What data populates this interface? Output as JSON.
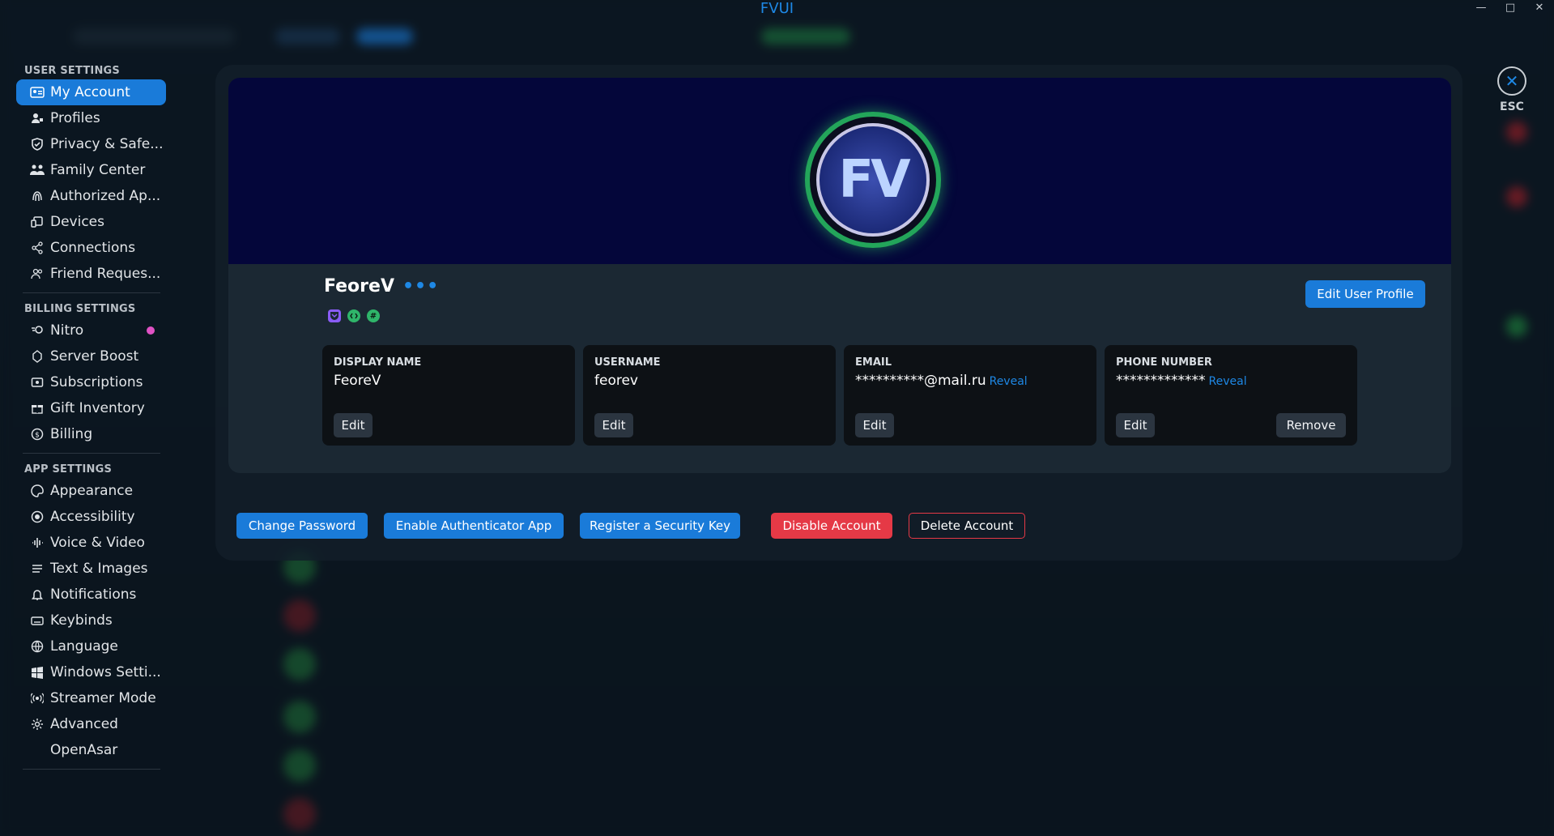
{
  "window": {
    "title": "FVUI"
  },
  "sidebar": {
    "sections": [
      {
        "heading": "USER SETTINGS",
        "items": [
          {
            "label": "My Account",
            "icon": "id-card-icon"
          },
          {
            "label": "Profiles",
            "icon": "person-edit-icon"
          },
          {
            "label": "Privacy & Safe...",
            "icon": "shield-icon"
          },
          {
            "label": "Family Center",
            "icon": "family-icon"
          },
          {
            "label": "Authorized Ap...",
            "icon": "fingerprint-icon"
          },
          {
            "label": "Devices",
            "icon": "devices-icon"
          },
          {
            "label": "Connections",
            "icon": "share-icon"
          },
          {
            "label": "Friend Reques...",
            "icon": "people-icon"
          }
        ]
      },
      {
        "heading": "BILLING SETTINGS",
        "items": [
          {
            "label": "Nitro",
            "icon": "nitro-icon"
          },
          {
            "label": "Server Boost",
            "icon": "boost-icon"
          },
          {
            "label": "Subscriptions",
            "icon": "subscriptions-icon"
          },
          {
            "label": "Gift Inventory",
            "icon": "gift-icon"
          },
          {
            "label": "Billing",
            "icon": "billing-icon"
          }
        ]
      },
      {
        "heading": "APP SETTINGS",
        "items": [
          {
            "label": "Appearance",
            "icon": "palette-icon"
          },
          {
            "label": "Accessibility",
            "icon": "accessibility-icon"
          },
          {
            "label": "Voice & Video",
            "icon": "waveform-icon"
          },
          {
            "label": "Text & Images",
            "icon": "text-lines-icon"
          },
          {
            "label": "Notifications",
            "icon": "bell-icon"
          },
          {
            "label": "Keybinds",
            "icon": "keyboard-icon"
          },
          {
            "label": "Language",
            "icon": "globe-icon"
          },
          {
            "label": "Windows Setti...",
            "icon": "windows-icon"
          },
          {
            "label": "Streamer Mode",
            "icon": "broadcast-icon"
          },
          {
            "label": "Advanced",
            "icon": "gear-icon"
          },
          {
            "label": "OpenAsar",
            "icon": ""
          }
        ]
      }
    ]
  },
  "profile": {
    "name": "FeoreV",
    "more": "•••",
    "avatar_text": "FV",
    "edit_profile_label": "Edit User Profile",
    "badges": [
      "nitro-badge",
      "dev-badge",
      "hashtag-badge"
    ]
  },
  "fields": [
    {
      "label": "DISPLAY NAME",
      "value": "FeoreV",
      "edit": "Edit"
    },
    {
      "label": "USERNAME",
      "value": "feorev",
      "edit": "Edit"
    },
    {
      "label": "EMAIL",
      "value": "**********@mail.ru",
      "reveal": "Reveal",
      "edit": "Edit"
    },
    {
      "label": "PHONE NUMBER",
      "value": "*************",
      "reveal": "Reveal",
      "edit": "Edit",
      "remove": "Remove"
    }
  ],
  "actions": {
    "change_password": "Change Password",
    "enable_authenticator": "Enable Authenticator App",
    "register_key": "Register a Security Key",
    "disable_account": "Disable Account",
    "delete_account": "Delete Account"
  },
  "esc": {
    "symbol": "✕",
    "label": "ESC"
  },
  "colors": {
    "accent": "#1a7bd9",
    "danger": "#e53946",
    "online": "#23a55a",
    "banner": "#04063a"
  }
}
